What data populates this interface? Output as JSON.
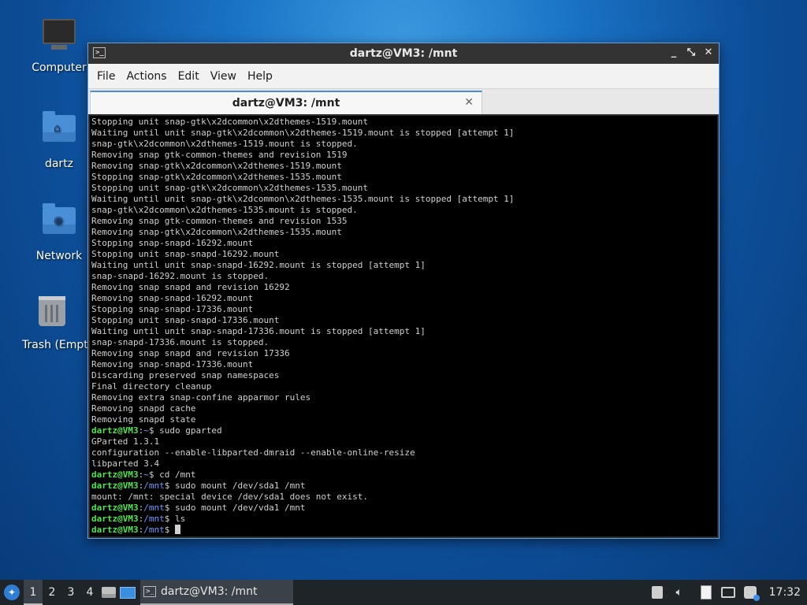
{
  "desktop": {
    "icons": [
      {
        "label": "Computer",
        "icon": "computer-icon"
      },
      {
        "label": "dartz",
        "icon": "home-folder-icon"
      },
      {
        "label": "Network",
        "icon": "network-folder-icon"
      },
      {
        "label": "Trash (Empty)",
        "icon": "trash-icon"
      }
    ]
  },
  "window": {
    "title": "dartz@VM3: /mnt",
    "controls": {
      "minimize": "_",
      "maximize": "⤡",
      "close": "✕"
    },
    "menu": [
      "File",
      "Actions",
      "Edit",
      "View",
      "Help"
    ],
    "tab": {
      "label": "dartz@VM3: /mnt",
      "close": "✕"
    }
  },
  "terminal": {
    "user": "dartz@VM3",
    "lines": [
      {
        "t": "Stopping unit snap-gtk\\x2dcommon\\x2dthemes-1519.mount"
      },
      {
        "t": "Waiting until unit snap-gtk\\x2dcommon\\x2dthemes-1519.mount is stopped [attempt 1]"
      },
      {
        "t": "snap-gtk\\x2dcommon\\x2dthemes-1519.mount is stopped."
      },
      {
        "t": "Removing snap gtk-common-themes and revision 1519"
      },
      {
        "t": "Removing snap-gtk\\x2dcommon\\x2dthemes-1519.mount"
      },
      {
        "t": "Stopping snap-gtk\\x2dcommon\\x2dthemes-1535.mount"
      },
      {
        "t": "Stopping unit snap-gtk\\x2dcommon\\x2dthemes-1535.mount"
      },
      {
        "t": "Waiting until unit snap-gtk\\x2dcommon\\x2dthemes-1535.mount is stopped [attempt 1]"
      },
      {
        "t": "snap-gtk\\x2dcommon\\x2dthemes-1535.mount is stopped."
      },
      {
        "t": "Removing snap gtk-common-themes and revision 1535"
      },
      {
        "t": "Removing snap-gtk\\x2dcommon\\x2dthemes-1535.mount"
      },
      {
        "t": "Stopping snap-snapd-16292.mount"
      },
      {
        "t": "Stopping unit snap-snapd-16292.mount"
      },
      {
        "t": "Waiting until unit snap-snapd-16292.mount is stopped [attempt 1]"
      },
      {
        "t": "snap-snapd-16292.mount is stopped."
      },
      {
        "t": "Removing snap snapd and revision 16292"
      },
      {
        "t": "Removing snap-snapd-16292.mount"
      },
      {
        "t": "Stopping snap-snapd-17336.mount"
      },
      {
        "t": "Stopping unit snap-snapd-17336.mount"
      },
      {
        "t": "Waiting until unit snap-snapd-17336.mount is stopped [attempt 1]"
      },
      {
        "t": "snap-snapd-17336.mount is stopped."
      },
      {
        "t": "Removing snap snapd and revision 17336"
      },
      {
        "t": "Removing snap-snapd-17336.mount"
      },
      {
        "t": "Discarding preserved snap namespaces"
      },
      {
        "t": "Final directory cleanup"
      },
      {
        "t": "Removing extra snap-confine apparmor rules"
      },
      {
        "t": "Removing snapd cache"
      },
      {
        "t": "Removing snapd state"
      },
      {
        "prompt": true,
        "path": "~",
        "cmd": " sudo gparted"
      },
      {
        "t": "GParted 1.3.1"
      },
      {
        "t": "configuration --enable-libparted-dmraid --enable-online-resize"
      },
      {
        "t": "libparted 3.4"
      },
      {
        "prompt": true,
        "path": "~",
        "cmd": " cd /mnt"
      },
      {
        "prompt": true,
        "path": "/mnt",
        "cmd": " sudo mount /dev/sda1 /mnt"
      },
      {
        "t": "mount: /mnt: special device /dev/sda1 does not exist."
      },
      {
        "prompt": true,
        "path": "/mnt",
        "cmd": " sudo mount /dev/vda1 /mnt"
      },
      {
        "prompt": true,
        "path": "/mnt",
        "cmd": " ls"
      },
      {
        "prompt": true,
        "path": "/mnt",
        "cmd": " ",
        "cursor": true
      }
    ]
  },
  "taskbar": {
    "workspaces": [
      "1",
      "2",
      "3",
      "4"
    ],
    "active_workspace": "1",
    "task_label": "dartz@VM3: /mnt",
    "clock": "17:32"
  },
  "colors": {
    "prompt_user": "#4ee44e",
    "prompt_path": "#6f9cff",
    "accent": "#4a90d9"
  }
}
